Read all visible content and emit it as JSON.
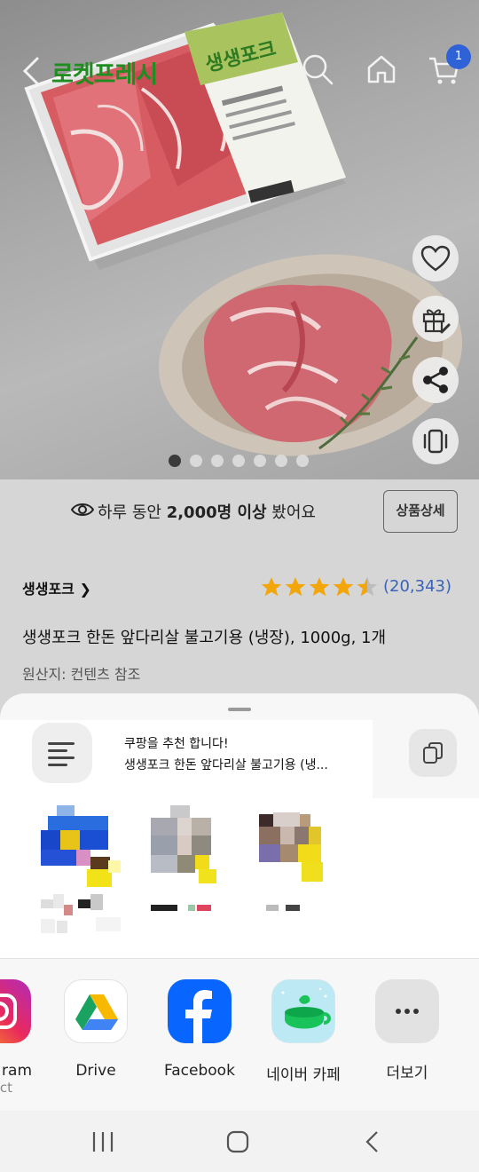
{
  "header": {
    "brand": "로켓프레시",
    "cart_count": "1"
  },
  "hero": {
    "package_label": "생생포크",
    "slide_count": 7,
    "active_slide": 0
  },
  "side_actions": [
    "heart-icon",
    "gift-icon",
    "share-icon",
    "vibrate-icon"
  ],
  "product": {
    "viewed_prefix": "하루 동안 ",
    "viewed_bold": "2,000명 이상",
    "viewed_suffix": " 봤어요",
    "detail_button": "상품상세",
    "brand_link": "생생포크 ❯",
    "rating": 4.5,
    "review_count": "(20,343)",
    "name": "생생포크 한돈 앞다리살 불고기용 (냉장), 1000g, 1개",
    "origin": "원산지: 컨텐츠 참조"
  },
  "share_sheet": {
    "title": "쿠팡을 추천 합니다!",
    "subtitle": "생생포크 한돈 앞다리살 불고기용 (냉...",
    "apps": [
      {
        "label": "ram",
        "sub": "ct"
      },
      {
        "label": "Drive",
        "sub": ""
      },
      {
        "label": "Facebook",
        "sub": ""
      },
      {
        "label": "네이버 카페",
        "sub": ""
      },
      {
        "label": "더보기",
        "sub": ""
      }
    ]
  },
  "colors": {
    "brand_green": "#1f8d1f",
    "badge_blue": "#2f62d6",
    "star": "#f2a60a",
    "review_link": "#3a63b8",
    "facebook": "#0866ff"
  }
}
